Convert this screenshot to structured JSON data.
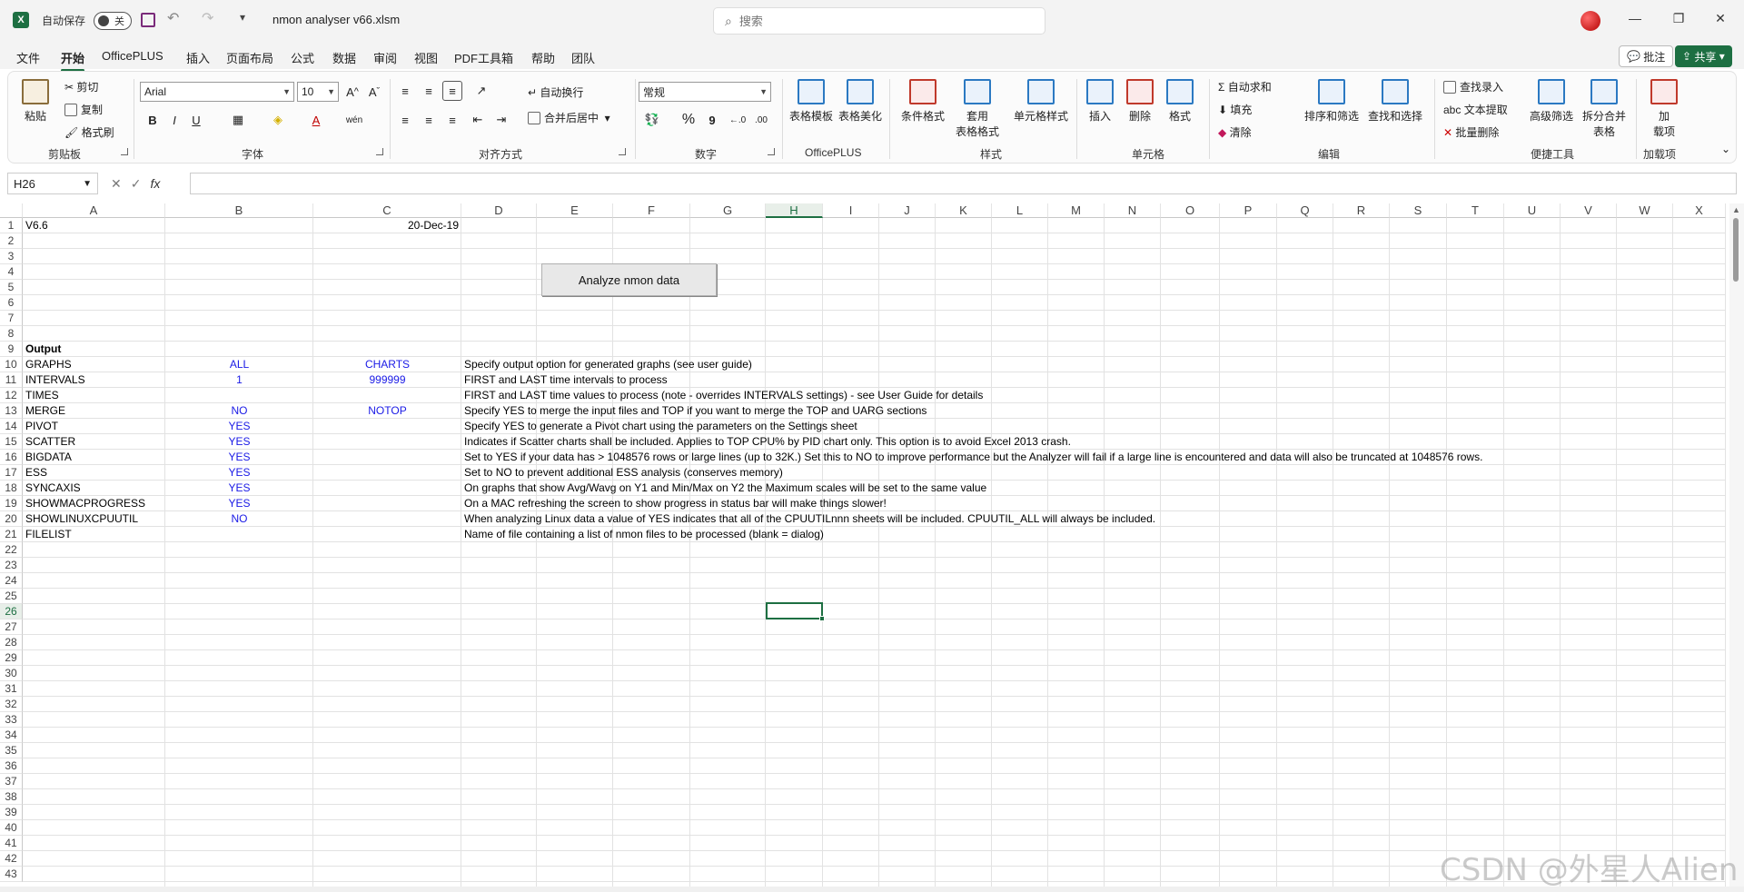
{
  "titlebar": {
    "app_icon": "X",
    "autosave_label": "自动保存",
    "autosave_state": "关",
    "doc_title": "nmon analyser v66.xlsm",
    "search_placeholder": "搜索"
  },
  "menu": {
    "tabs": [
      "文件",
      "开始",
      "OfficePLUS",
      "插入",
      "页面布局",
      "公式",
      "数据",
      "审阅",
      "视图",
      "PDF工具箱",
      "帮助",
      "团队"
    ],
    "active": "开始",
    "comment_label": "批注",
    "share_label": "共享"
  },
  "ribbon": {
    "clipboard": {
      "paste": "粘贴",
      "cut": "剪切",
      "copy": "复制",
      "format_painter": "格式刷",
      "group": "剪贴板"
    },
    "font": {
      "name": "Arial",
      "size": "10",
      "bold": "B",
      "italic": "I",
      "underline": "U",
      "group": "字体"
    },
    "align": {
      "wrap": "自动换行",
      "merge": "合并后居中",
      "group": "对齐方式"
    },
    "number": {
      "format": "常规",
      "percent": "%",
      "comma": "9",
      "group": "数字"
    },
    "officeplus": {
      "table_template": "表格模板",
      "table_beautify": "表格美化",
      "group": "OfficePLUS"
    },
    "styles": {
      "cond_format": "条件格式",
      "table_format_1": "套用",
      "table_format_2": "表格格式",
      "cell_style": "单元格样式",
      "group": "样式"
    },
    "cells": {
      "insert": "插入",
      "delete": "删除",
      "format": "格式",
      "group": "单元格"
    },
    "edit": {
      "autosum": "自动求和",
      "fill": "填充",
      "clear": "清除",
      "sort_filter": "排序和筛选",
      "find_select": "查找和选择",
      "group": "编辑"
    },
    "tools": {
      "find_entry": "查找录入",
      "text_extract": "文本提取",
      "batch_delete": "批量删除",
      "adv_filter": "高级筛选",
      "split_merge_1": "拆分合并",
      "split_merge_2": "表格",
      "group": "便捷工具"
    },
    "addins": {
      "addin_1": "加",
      "addin_2": "载项",
      "group": "加载项"
    }
  },
  "formula_bar": {
    "name_box": "H26",
    "fx": "fx",
    "formula": ""
  },
  "sheet": {
    "columns": [
      "A",
      "B",
      "C",
      "D",
      "E",
      "F",
      "G",
      "H",
      "I",
      "J",
      "K",
      "L",
      "M",
      "N",
      "O",
      "P",
      "Q",
      "R",
      "S",
      "T",
      "U",
      "V",
      "W",
      "X"
    ],
    "selected_column": "H",
    "selected_row": 26,
    "row_count": 43,
    "analyze_button": "Analyze nmon data",
    "cells": {
      "A1": "V6.6",
      "C1": "20-Dec-19",
      "A9": "Output",
      "A10": "GRAPHS",
      "B10": "ALL",
      "C10": "CHARTS",
      "D10": "Specify output option for generated graphs (see user guide)",
      "A11": "INTERVALS",
      "B11": "1",
      "C11": "999999",
      "D11": "FIRST and LAST time intervals to process",
      "A12": "TIMES",
      "D12": "FIRST and LAST time values to process (note - overrides INTERVALS settings) - see User Guide for details",
      "A13": "MERGE",
      "B13": "NO",
      "C13": "NOTOP",
      "D13": "Specify YES to merge the input files and TOP if you want to merge the TOP and UARG sections",
      "A14": "PIVOT",
      "B14": "YES",
      "D14": "Specify YES to generate a Pivot chart using the parameters on the Settings sheet",
      "A15": "SCATTER",
      "B15": "YES",
      "D15": "Indicates if Scatter charts shall be included.  Applies to TOP CPU% by PID chart only.  This option is to avoid Excel 2013 crash.",
      "A16": "BIGDATA",
      "B16": "YES",
      "D16": "Set to YES if your data has > 1048576 rows or large lines (up to 32K.)  Set this to NO to improve performance but the Analyzer will fail if a large line is encountered and data will also be truncated at 1048576 rows.",
      "A17": "ESS",
      "B17": "YES",
      "D17": "Set to NO to prevent additional ESS analysis (conserves memory)",
      "A18": "SYNCAXIS",
      "B18": "YES",
      "D18": "On graphs that show Avg/Wavg on Y1 and Min/Max on Y2 the Maximum scales will be set to the same value",
      "A19": "SHOWMACPROGRESS",
      "B19": "YES",
      "D19": "On a MAC refreshing the screen to show progress in status bar will make things slower!",
      "A20": "SHOWLINUXCPUUTIL",
      "B20": "NO",
      "D20": "When analyzing Linux data a value of YES indicates that all of the CPUUTILnnn sheets will be included.  CPUUTIL_ALL will always be included.",
      "A21": "FILELIST",
      "D21": "Name of file containing a list of nmon files to be processed (blank = dialog)"
    }
  },
  "watermark": "CSDN @外星人Alien",
  "colors": {
    "accent": "#1d6f42",
    "blue_text": "#1a1ae6"
  }
}
